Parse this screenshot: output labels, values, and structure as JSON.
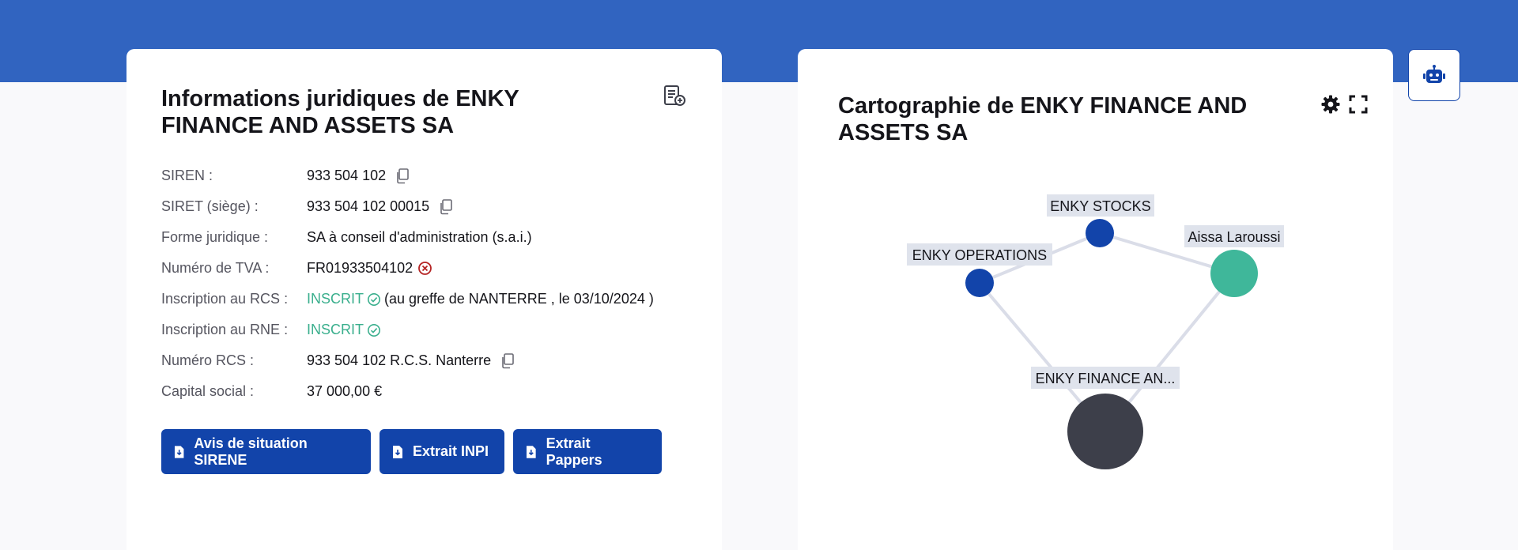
{
  "legal_card": {
    "title": "Informations juridiques de ENKY FINANCE AND ASSETS SA",
    "rows": [
      {
        "label": "SIREN :",
        "value": "933 504 102"
      },
      {
        "label": "SIRET (siège) :",
        "value": "933 504 102 00015"
      },
      {
        "label": "Forme juridique :",
        "value": "SA à conseil d'administration (s.a.i.)"
      },
      {
        "label": "Numéro de TVA :",
        "value": "FR01933504102"
      },
      {
        "label": "Inscription au RCS :",
        "value": "INSCRIT",
        "detail": "(au greffe de NANTERRE , le 03/10/2024 )"
      },
      {
        "label": "Inscription au RNE :",
        "value": "INSCRIT"
      },
      {
        "label": "Numéro RCS :",
        "value": "933 504 102 R.C.S. Nanterre"
      },
      {
        "label": "Capital social :",
        "value": "37 000,00 €"
      }
    ],
    "buttons": {
      "sirene": "Avis de situation SIRENE",
      "inpi": "Extrait INPI",
      "pappers": "Extrait Pappers"
    },
    "status_color": "#3aaf8d",
    "error_color": "#b52424"
  },
  "map_card": {
    "title": "Cartographie de ENKY FINANCE AND ASSETS SA",
    "nodes": {
      "stocks": "ENKY STOCKS",
      "operations": "ENKY OPERATIONS",
      "person": "Aissa Laroussi",
      "main": "ENKY FINANCE AN..."
    },
    "colors": {
      "company_node": "#1244aa",
      "person_node": "#3fb79a",
      "main_node": "#3d3f4a",
      "edge": "#dadde8",
      "label_bg": "#dfe3ec"
    }
  },
  "theme": {
    "brand": "#3164c0",
    "button": "#1244aa"
  }
}
